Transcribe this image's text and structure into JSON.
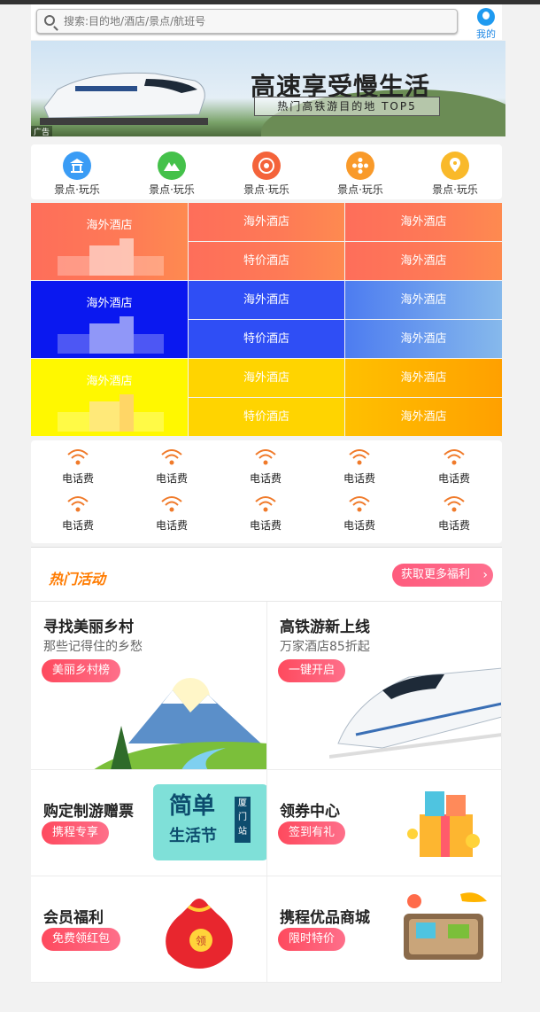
{
  "search": {
    "placeholder": "搜索:目的地/酒店/景点/航班号"
  },
  "me": {
    "label": "我的"
  },
  "banner": {
    "title": "高速享受慢生活",
    "subtitle": "热门高铁游目的地 TOP5",
    "ad_tag": "广告"
  },
  "quick_nav": [
    {
      "label": "景点·玩乐",
      "icon": "temple-icon",
      "color": "#3a9cf5"
    },
    {
      "label": "景点·玩乐",
      "icon": "mountain-icon",
      "color": "#44c14a"
    },
    {
      "label": "景点·玩乐",
      "icon": "compass-icon",
      "color": "#f4633a"
    },
    {
      "label": "景点·玩乐",
      "icon": "flower-icon",
      "color": "#f99a2a"
    },
    {
      "label": "景点·玩乐",
      "icon": "location-pin-icon",
      "color": "#f9b92a"
    }
  ],
  "hotel_grid": [
    {
      "big": "海外酒店",
      "cells": [
        "海外酒店",
        "海外酒店",
        "特价酒店",
        "海外酒店"
      ]
    },
    {
      "big": "海外酒店",
      "cells": [
        "海外酒店",
        "海外酒店",
        "特价酒店",
        "海外酒店"
      ]
    },
    {
      "big": "海外酒店",
      "cells": [
        "海外酒店",
        "海外酒店",
        "特价酒店",
        "海外酒店"
      ]
    }
  ],
  "phone_items": [
    "电话费",
    "电话费",
    "电话费",
    "电话费",
    "电话费",
    "电话费",
    "电话费",
    "电话费",
    "电话费",
    "电话费"
  ],
  "activity": {
    "title": "热门活动",
    "more": "获取更多福利",
    "cards": [
      {
        "title": "寻找美丽乡村",
        "sub": "那些记得住的乡愁",
        "btn": "美丽乡村榜"
      },
      {
        "title": "高铁游新上线",
        "sub": "万家酒店85折起",
        "btn": "一键开启"
      },
      {
        "title": "购定制游赠票",
        "btn": "携程专享",
        "art": {
          "big": "简单",
          "big2": "生活节",
          "side": "厦门站"
        }
      },
      {
        "title": "领券中心",
        "btn": "签到有礼"
      },
      {
        "title": "会员福利",
        "btn": "免费领红包",
        "art": {
          "bag": "领"
        }
      },
      {
        "title": "携程优品商城",
        "btn": "限时特价"
      }
    ]
  }
}
